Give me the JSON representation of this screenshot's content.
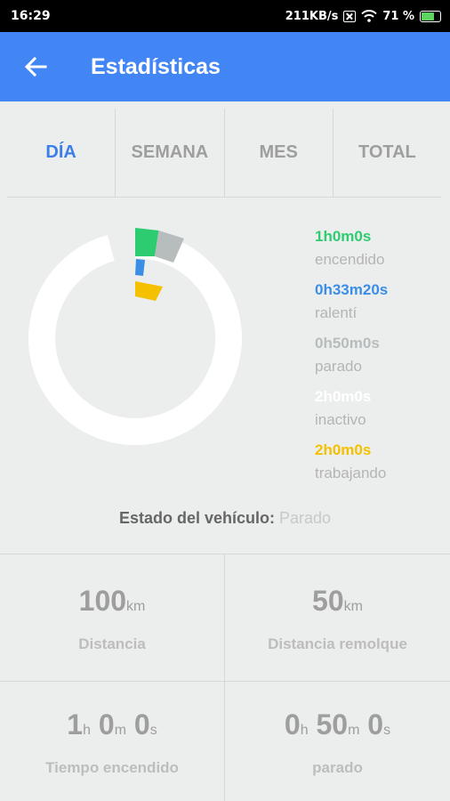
{
  "status_bar": {
    "time": "16:29",
    "network_speed": "211KB/s",
    "battery": "71 %"
  },
  "header": {
    "title": "Estadísticas"
  },
  "tabs": [
    {
      "label": "DÍA",
      "active": true
    },
    {
      "label": "SEMANA",
      "active": false
    },
    {
      "label": "MES",
      "active": false
    },
    {
      "label": "TOTAL",
      "active": false
    }
  ],
  "legend": [
    {
      "value": "1h0m0s",
      "label": "encendido",
      "color": "#2ecc71"
    },
    {
      "value": "0h33m20s",
      "label": "ralentí",
      "color": "#3a8ee6"
    },
    {
      "value": "0h50m0s",
      "label": "parado",
      "color": "#b7bcbd"
    },
    {
      "value": "2h0m0s",
      "label": "inactivo",
      "color": "#ffffff"
    },
    {
      "value": "2h0m0s",
      "label": "trabajando",
      "color": "#f5c000"
    }
  ],
  "vehicle_state": {
    "label": "Estado del vehículo:",
    "value": "Parado"
  },
  "stats": {
    "distance": {
      "value": "100",
      "unit": "km",
      "label": "Distancia"
    },
    "trailer_distance": {
      "value": "50",
      "unit": "km",
      "label": "Distancia remolque"
    },
    "on_time": {
      "h": "1",
      "h_unit": "h",
      "m": "0",
      "m_unit": "m",
      "s": "0",
      "s_unit": "s",
      "label": "Tiempo encendido"
    },
    "stopped_time": {
      "h": "0",
      "h_unit": "h",
      "m": "50",
      "m_unit": "m",
      "s": "0",
      "s_unit": "s",
      "label": "parado"
    }
  }
}
